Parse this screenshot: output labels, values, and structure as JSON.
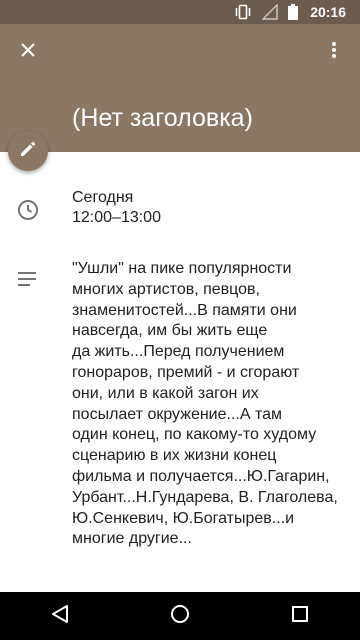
{
  "status_bar": {
    "time": "20:16",
    "icons": [
      "vibrate-icon",
      "signal-icon",
      "battery-icon"
    ]
  },
  "header": {
    "title": "(Нет заголовка)",
    "close_icon": "close-icon",
    "more_icon": "more-vert-icon",
    "color": "#8b7764"
  },
  "fab": {
    "icon": "edit-pencil-icon"
  },
  "event": {
    "date": "Сегодня",
    "time_range": "12:00–13:00",
    "description_lines": [
      "\"Ушли\" на пике популярности",
      "многих артистов, певцов,",
      "знаменитостей...В памяти они",
      "навсегда, им бы жить еще",
      "да жить...Перед получением",
      "гонораров, премий - и сгорают",
      "они, или в какой загон их",
      "посылает окружение...А там",
      "один конец, по какому-то худому",
      "сценарию в их жизни конец",
      "фильма и получается...Ю.Гагарин,",
      "Урбант...Н.Гундарева, В. Глаголева,",
      "Ю.Сенкевич, Ю.Богатырев...и",
      "многие другие..."
    ]
  },
  "nav_bar": {
    "icons": [
      "back-icon",
      "home-icon",
      "recents-icon"
    ]
  }
}
